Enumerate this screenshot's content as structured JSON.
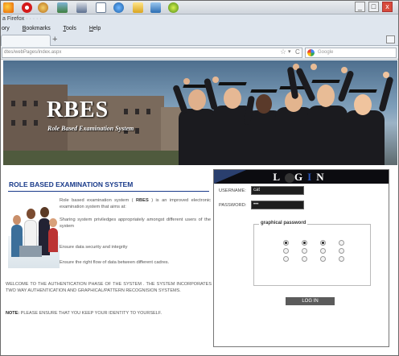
{
  "browser": {
    "title_fragment": "a Firefox",
    "title_faded": "   ·   ·   ·   ·   ·",
    "menu": [
      {
        "label": "ory",
        "underline": ""
      },
      {
        "label": "ookmarks",
        "underline": "B"
      },
      {
        "label": "ools",
        "underline": "T"
      },
      {
        "label": "elp",
        "underline": "H"
      }
    ],
    "new_tab": "+",
    "url": "dtes/webPages/index.aspx",
    "url_star": "☆",
    "url_arrow": "▾",
    "url_reload": "C",
    "search_placeholder": "Google",
    "window_controls": [
      "_",
      "□",
      "x"
    ]
  },
  "banner": {
    "title": "RBES",
    "subtitle": "Role Based Examination System"
  },
  "content": {
    "heading": "ROLE BASED EXAMINATION SYSTEM",
    "intro_before": "Role based examination system ( ",
    "intro_bold": "RBES",
    "intro_after": " ) is an improved electronic examination system that aims at:",
    "aims": [
      "Sharing system priviledges appropriately amongst different users of the system",
      "Ensure data security and integrity",
      "Ensure the right flow of data between different cadres."
    ],
    "welcome": "WELCOME TO THE AUTHENTICATION PHASE OF THE SYSTEM . THE SYSTEM INCORPORATES TWO WAY AUTHENTICATION AND GRAPHICAL/PATTERN RECOGNISION SYSTEMS.",
    "note_label": "NOTE:",
    "note_text": " PLEASE ENSURE THAT YOU KEEP YOUR IDENTITY TO YOURSELF."
  },
  "login": {
    "header_parts": [
      "L",
      "G",
      "I",
      "N"
    ],
    "username_label": "USERNAME:",
    "username_value": "cat",
    "password_label": "PASSWORD:",
    "password_value": "•••",
    "graphical_label": "graphical password",
    "pattern_rows": [
      [
        true,
        true,
        true,
        false
      ],
      [
        false,
        false,
        false,
        false
      ],
      [
        false,
        false,
        false,
        false
      ]
    ],
    "button_label": "LOG IN"
  }
}
